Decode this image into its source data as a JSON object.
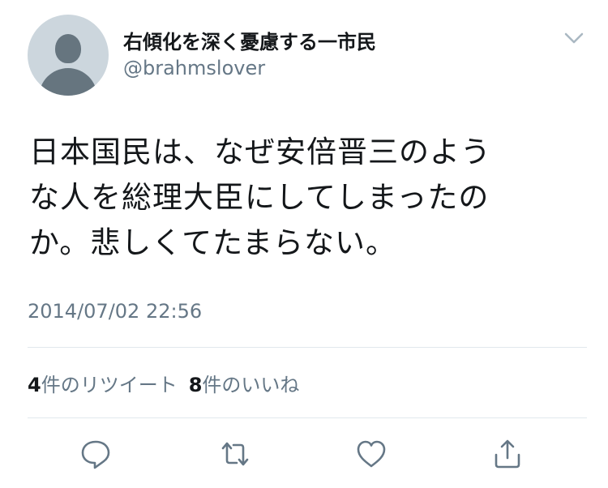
{
  "user": {
    "display_name": "右傾化を深く憂慮する一市民",
    "username": "@brahmslover"
  },
  "tweet": {
    "text": "日本国民は、なぜ安倍晋三のよう\nな人を総理大臣にしてしまったの\nか。悲しくてたまらない。",
    "timestamp": "2014/07/02 22:56"
  },
  "stats": {
    "retweet_count": "4",
    "retweet_label": "件のリツイート",
    "like_count": "8",
    "like_label": "件のいいね"
  },
  "icons": {
    "menu": "chevron-down-icon",
    "reply": "reply-icon",
    "retweet": "retweet-icon",
    "like": "heart-icon",
    "share": "share-icon"
  },
  "colors": {
    "text": "#14171a",
    "secondary": "#657786",
    "divider": "#e1e8ed",
    "avatar_bg": "#ccd6dd",
    "avatar_fg": "#66757f"
  }
}
